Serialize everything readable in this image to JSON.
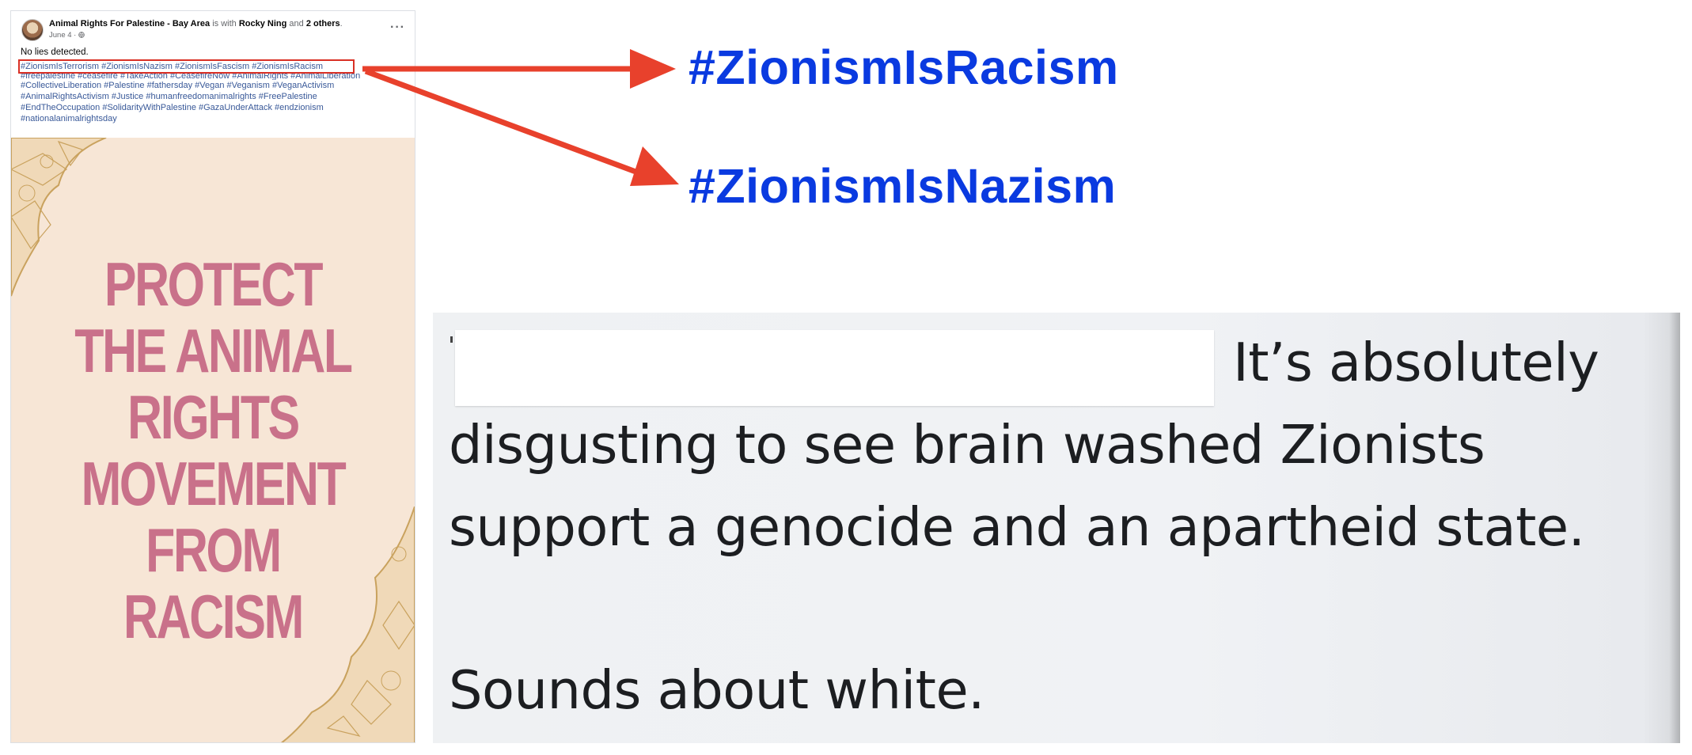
{
  "post": {
    "page_name": "Animal Rights For Palestine - Bay Area",
    "with_text": "is with",
    "tagged_person": "Rocky Ning",
    "and_text": "and",
    "others": "2 others",
    "period": ".",
    "date": "June 4 · ",
    "audience_icon": "globe-icon",
    "more_label": "···",
    "caption": "No lies detected.",
    "highlighted_tags": [
      "#ZionismIsTerrorism",
      "#ZionismIsNazism",
      "#ZionismIsFascism",
      "#ZionismIsRacism"
    ],
    "tag_lines": [
      "#freepalestine #ceasefire #TakeAction #CeasefireNow #AnimalRights #AnimalLiberation",
      "#CollectiveLiberation #Palestine #fathersday #Vegan #Veganism #VeganActivism",
      "#AnimalRightsActivism #Justice #humanfreedomanimalrights #FreePalestine",
      "#EndTheOccupation #SolidarityWithPalestine #GazaUnderAttack #endzionism",
      "#nationalanimalrightsday"
    ],
    "poster_lines": [
      "PROTECT",
      "THE ANIMAL",
      "RIGHTS",
      "MOVEMENT",
      "FROM",
      "RACISM"
    ]
  },
  "callouts": {
    "tag_one": "#ZionismIsRacism",
    "tag_two": "#ZionismIsNazism",
    "arrow_color": "#e8412c",
    "tag_color": "#0a3ae0"
  },
  "comment": {
    "line1": "It’s absolutely",
    "line2": "disgusting to see brain washed Zionists",
    "line3": "support a genocide and an apartheid state.",
    "line4": "Sounds about white."
  }
}
